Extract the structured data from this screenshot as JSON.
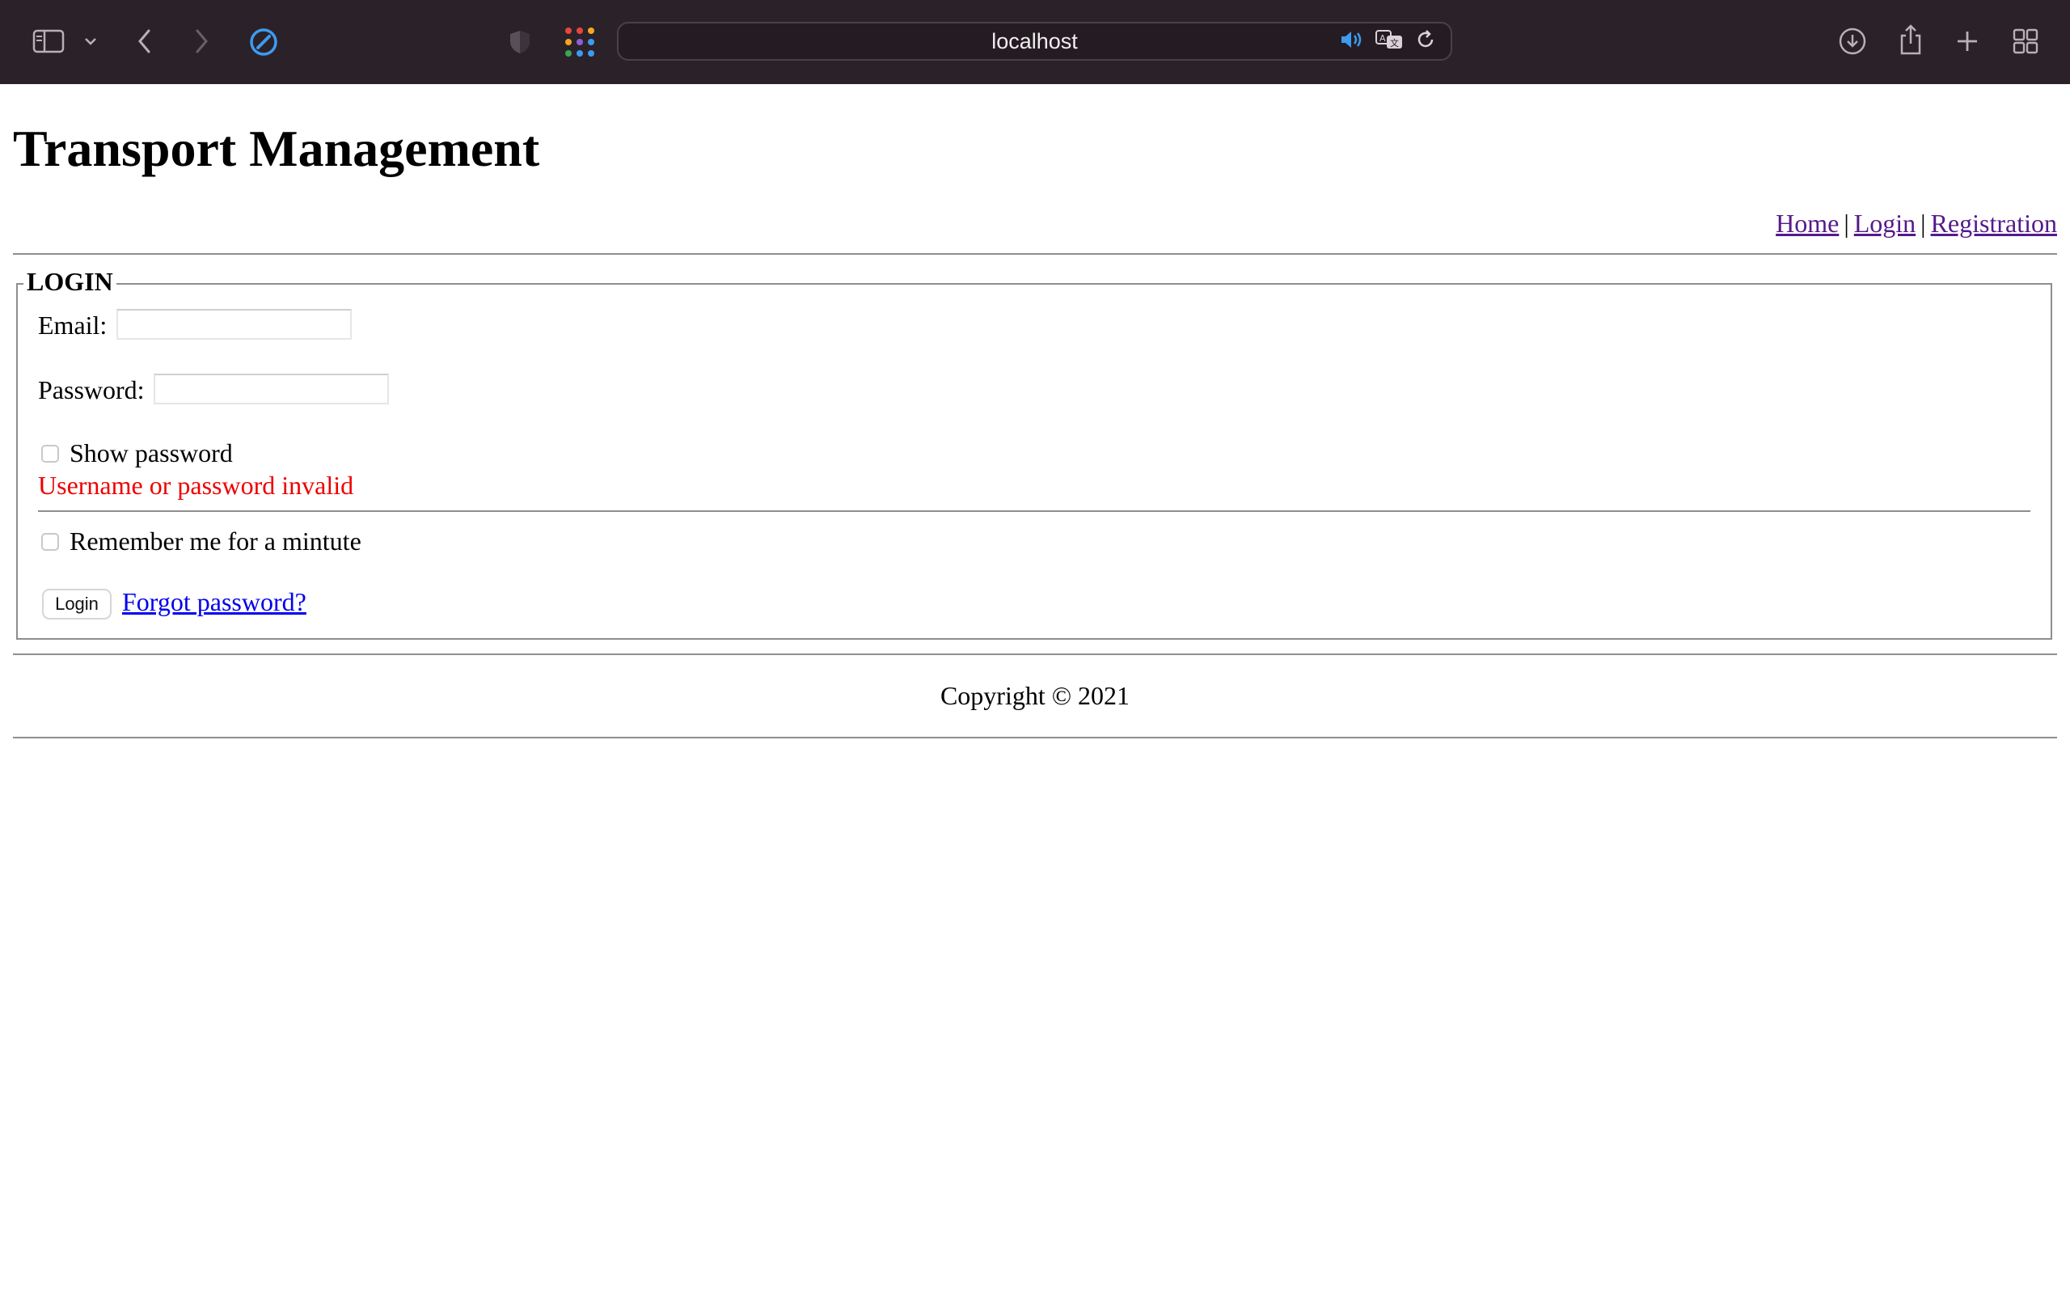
{
  "browser": {
    "url": "localhost",
    "icons": [
      "sidebar-icon",
      "chevron-down-icon",
      "back-icon",
      "forward-icon",
      "compass-icon",
      "shield-icon",
      "apps-grid-icon",
      "speaker-icon",
      "translate-icon",
      "reload-icon",
      "download-icon",
      "share-icon",
      "new-tab-icon",
      "tab-overview-icon"
    ]
  },
  "page": {
    "title": "Transport Management",
    "nav": {
      "home": "Home",
      "separator": "|",
      "login": "Login",
      "registration": "Registration"
    },
    "login_form": {
      "legend": "LOGIN",
      "email_label": "Email:",
      "email_value": "",
      "password_label": "Password:",
      "password_value": "",
      "show_password_label": "Show password",
      "error_message": "Username or password invalid",
      "remember_label": "Remember me for a mintute",
      "login_button": "Login",
      "forgot_link": "Forgot password?"
    },
    "footer": {
      "copyright": "Copyright © 2021"
    }
  },
  "colors": {
    "toolbar_bg": "#2b2129",
    "visited_link": "#551a8b",
    "link": "#0000ee",
    "error": "#ee0000",
    "accent_blue": "#3d9bf0"
  }
}
